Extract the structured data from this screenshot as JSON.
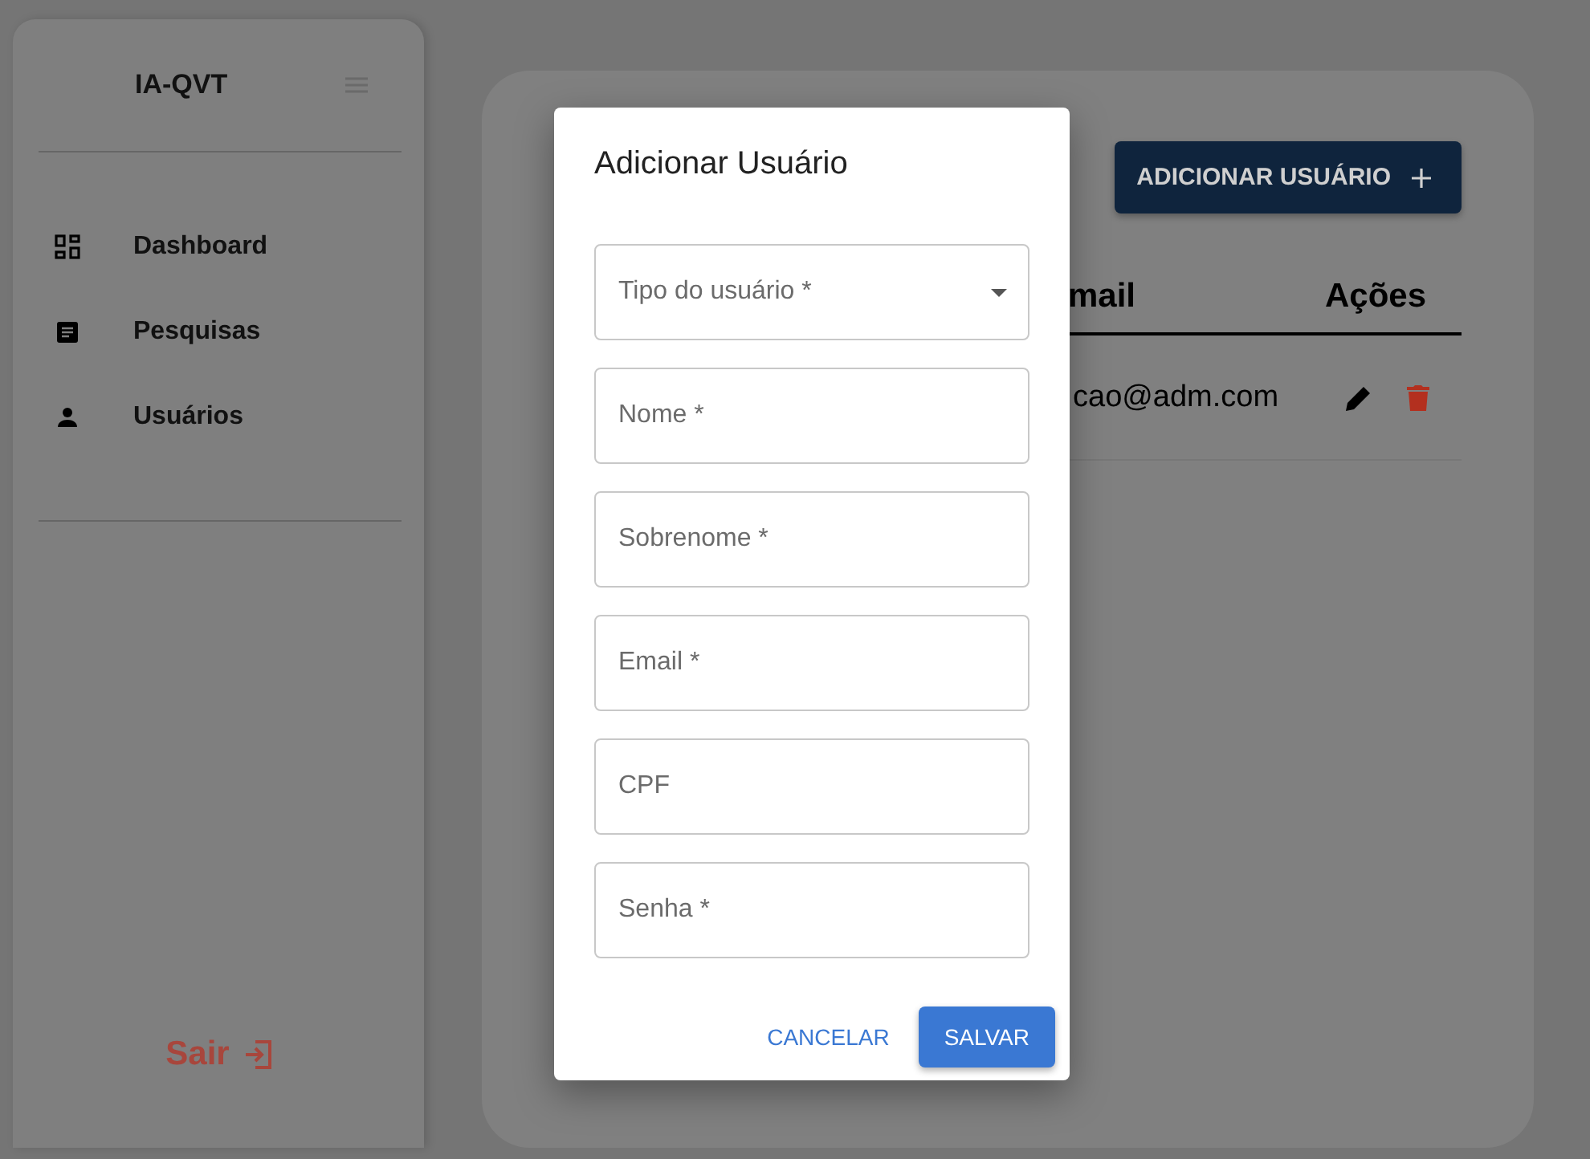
{
  "sidebar": {
    "brand": "IA-QVT",
    "items": [
      {
        "kind": "dashboard",
        "label": "Dashboard"
      },
      {
        "kind": "survey",
        "label": "Pesquisas"
      },
      {
        "kind": "user",
        "label": "Usuários"
      }
    ],
    "logout": "Sair"
  },
  "main": {
    "add_button": "ADICIONAR USUÁRIO",
    "table": {
      "columns": [
        "mail",
        "Ações"
      ],
      "rows": [
        {
          "email": "cao@adm.com"
        }
      ]
    }
  },
  "dialog": {
    "title": "Adicionar Usuário",
    "fields": [
      {
        "kind": "select",
        "placeholder": "Tipo do usuário *"
      },
      {
        "kind": "text",
        "placeholder": "Nome *"
      },
      {
        "kind": "text",
        "placeholder": "Sobrenome *"
      },
      {
        "kind": "text",
        "placeholder": "Email *"
      },
      {
        "kind": "text",
        "placeholder": "CPF"
      },
      {
        "kind": "text",
        "placeholder": "Senha *"
      }
    ],
    "buttons": [
      {
        "kind": "text",
        "label": "CANCELAR"
      },
      {
        "kind": "filled",
        "label": "SALVAR"
      }
    ]
  }
}
